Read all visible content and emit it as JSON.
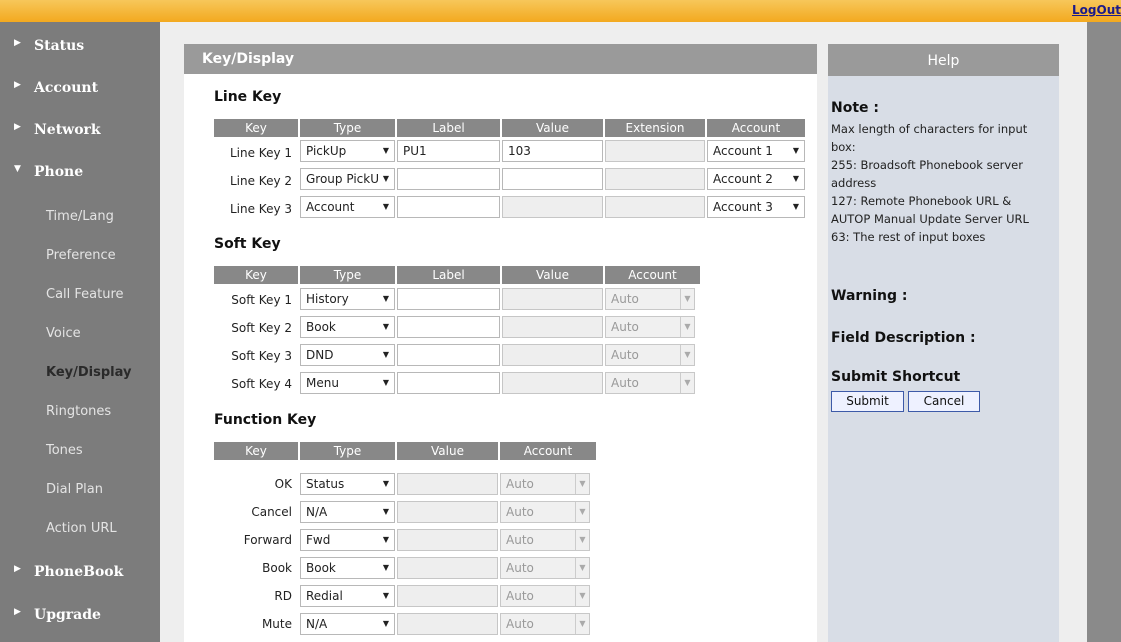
{
  "header": {
    "logout_label": "LogOut"
  },
  "sidebar": {
    "main": [
      {
        "label": "Status",
        "top": 0
      },
      {
        "label": "Account"
      },
      {
        "label": "Network"
      },
      {
        "label": "Phone"
      }
    ],
    "sub": [
      "Time/Lang",
      "Preference",
      "Call Feature",
      "Voice",
      "Key/Display",
      "Ringtones",
      "Tones",
      "Dial Plan",
      "Action URL"
    ],
    "bottom": [
      "PhoneBook",
      "Upgrade"
    ]
  },
  "panel": {
    "title": "Key/Display",
    "line_key": {
      "title": "Line Key",
      "headers": [
        "Key",
        "Type",
        "Label",
        "Value",
        "Extension",
        "Account"
      ],
      "rows": [
        {
          "key": "Line Key 1",
          "type": "PickUp",
          "label": "PU1",
          "value": "103",
          "extension": "",
          "account": "Account 1"
        },
        {
          "key": "Line Key 2",
          "type": "Group PickU",
          "label": "",
          "value": "",
          "extension": "",
          "account": "Account 2"
        },
        {
          "key": "Line Key 3",
          "type": "Account",
          "label": "",
          "value": "",
          "extension": "",
          "account": "Account 3"
        }
      ]
    },
    "soft_key": {
      "title": "Soft Key",
      "headers": [
        "Key",
        "Type",
        "Label",
        "Value",
        "Account"
      ],
      "rows": [
        {
          "key": "Soft Key 1",
          "type": "History",
          "account": "Auto"
        },
        {
          "key": "Soft Key 2",
          "type": "Book",
          "account": "Auto"
        },
        {
          "key": "Soft Key 3",
          "type": "DND",
          "account": "Auto"
        },
        {
          "key": "Soft Key 4",
          "type": "Menu",
          "account": "Auto"
        }
      ]
    },
    "function_key": {
      "title": "Function Key",
      "headers": [
        "Key",
        "Type",
        "Value",
        "Account"
      ],
      "rows": [
        {
          "key": "OK",
          "type": "Status",
          "account": "Auto"
        },
        {
          "key": "Cancel",
          "type": "N/A",
          "account": "Auto"
        },
        {
          "key": "Forward",
          "type": "Fwd",
          "account": "Auto"
        },
        {
          "key": "Book",
          "type": "Book",
          "account": "Auto"
        },
        {
          "key": "RD",
          "type": "Redial",
          "account": "Auto"
        },
        {
          "key": "Mute",
          "type": "N/A",
          "account": "Auto"
        }
      ]
    }
  },
  "help": {
    "title": "Help",
    "note_title": "Note :",
    "note_lines": [
      "Max length of characters for input",
      "box:",
      "255: Broadsoft Phonebook server",
      "address",
      "127: Remote Phonebook URL &",
      "AUTOP Manual Update Server URL",
      "63: The rest of input boxes"
    ],
    "warning_title": "Warning :",
    "field_desc_title": "Field Description :",
    "shortcut_title": "Submit Shortcut",
    "submit_label": "Submit",
    "cancel_label": "Cancel"
  },
  "icons": {
    "expand": "triangle-right-icon",
    "collapse": "triangle-down-icon",
    "dropdown": "chevron-down-icon"
  }
}
